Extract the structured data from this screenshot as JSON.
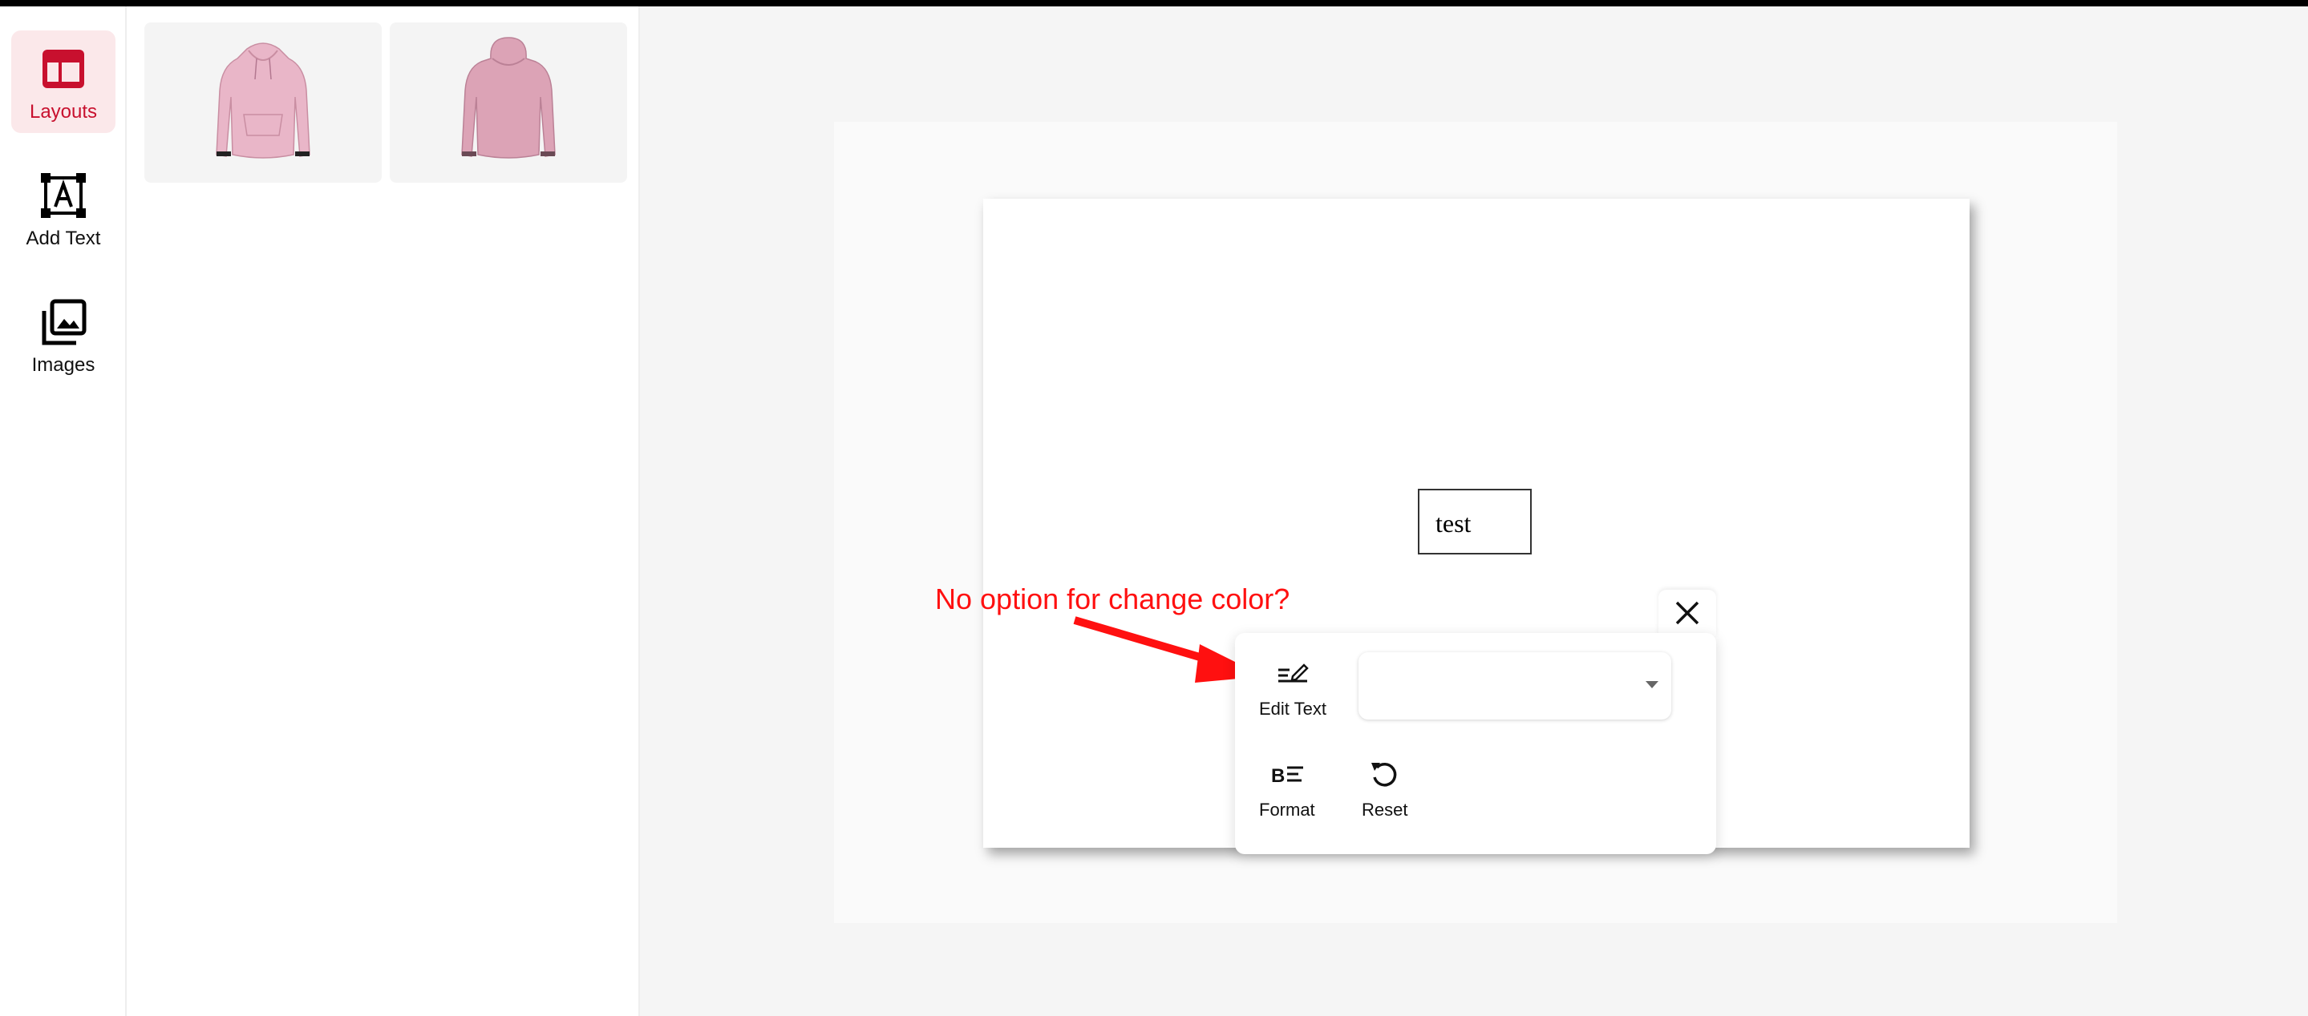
{
  "sidebar": {
    "items": [
      {
        "label": "Layouts",
        "icon": "layout-icon",
        "active": true
      },
      {
        "label": "Add Text",
        "icon": "add-text-icon",
        "active": false
      },
      {
        "label": "Images",
        "icon": "images-icon",
        "active": false
      }
    ]
  },
  "layouts": {
    "items": [
      {
        "icon": "hoodie-front-icon",
        "color": "#e9b6c8"
      },
      {
        "icon": "hoodie-back-icon",
        "color": "#dca3b6"
      }
    ]
  },
  "canvas": {
    "text_value": "test"
  },
  "text_toolbar": {
    "edit_text_label": "Edit Text",
    "format_label": "Format",
    "reset_label": "Reset",
    "font_select_value": "",
    "close_icon": "close-icon"
  },
  "annotation": {
    "text": "No option for change color?",
    "color": "#ff1010"
  },
  "colors": {
    "accent": "#c8102e",
    "active_bg": "#fbe8ea"
  }
}
